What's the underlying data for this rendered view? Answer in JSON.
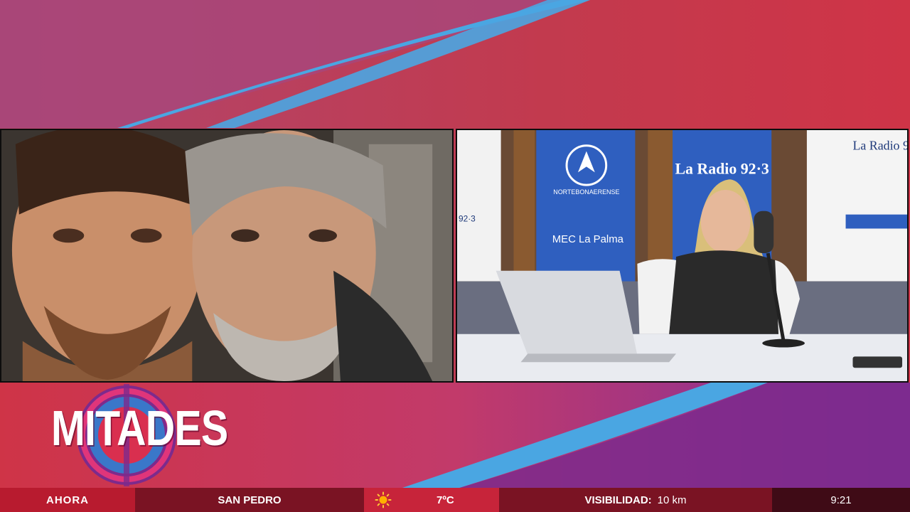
{
  "show": {
    "logo_text": "MITADES"
  },
  "colors": {
    "background": "#cf3447",
    "accent_blue": "#4da3e0",
    "purple": "#7d2a8c",
    "ticker_dark": "#7a1323"
  },
  "feeds": [
    {
      "name": "remote-guests-video"
    },
    {
      "name": "studio-video",
      "studio_signs": [
        "La Radio 92·3",
        "NORTEBONAERENSE",
        "MEC La Palma",
        "La Radio 9",
        "92·3"
      ]
    }
  ],
  "ticker": {
    "now_label": "AHORA",
    "location": "SAN PEDRO",
    "weather_icon": "sun-icon",
    "temperature": "7ºC",
    "visibility_label": "VISIBILIDAD:",
    "visibility_value": "10 km",
    "time": "9:21"
  }
}
